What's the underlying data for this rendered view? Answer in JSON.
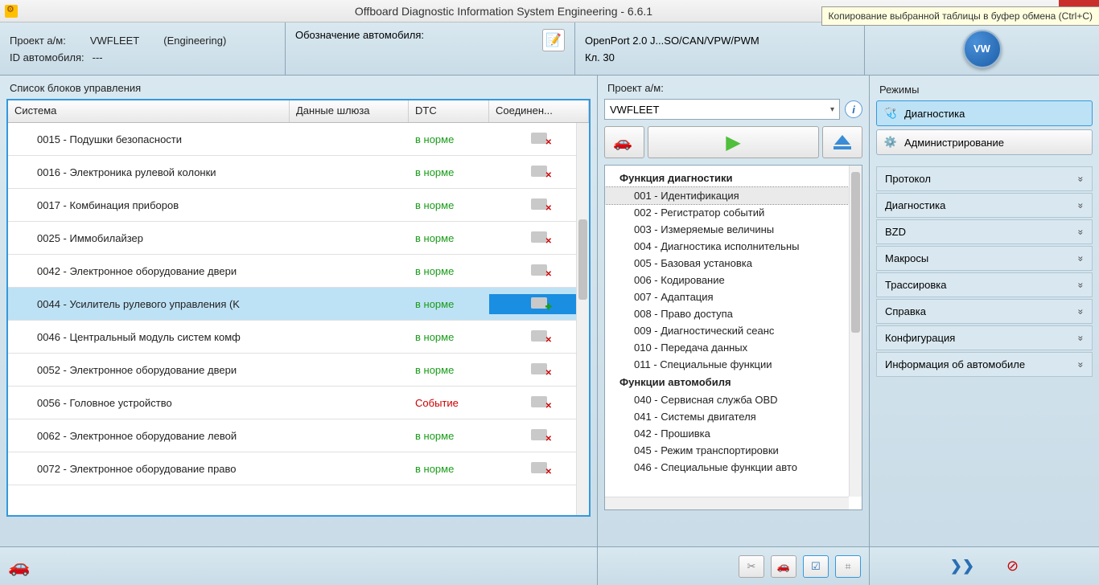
{
  "window": {
    "title": "Offboard Diagnostic Information System Engineering - 6.6.1"
  },
  "infobar": {
    "project_label": "Проект а/м:",
    "project_value": "VWFLEET",
    "engineering": "(Engineering)",
    "id_label": "ID автомобиля:",
    "id_value": "---",
    "designation_label": "Обозначение автомобиля:",
    "interface": "OpenPort 2.0 J...SO/CAN/VPW/PWM",
    "clamp": "Кл. 30",
    "logo_text": "VW"
  },
  "table": {
    "title": "Список блоков управления",
    "columns": {
      "sys": "Система",
      "gw": "Данные шлюза",
      "dtc": "DTC",
      "conn": "Соединен..."
    },
    "dtc_ok": "в норме",
    "dtc_event": "Событие",
    "rows": [
      {
        "sys": "0015 - Подушки безопасности",
        "dtc": "ok",
        "conn": "err"
      },
      {
        "sys": "0016 - Электроника рулевой колонки",
        "dtc": "ok",
        "conn": "err"
      },
      {
        "sys": "0017 - Комбинация приборов",
        "dtc": "ok",
        "conn": "err"
      },
      {
        "sys": "0025 - Иммобилайзер",
        "dtc": "ok",
        "conn": "err"
      },
      {
        "sys": "0042 - Электронное оборудование двери",
        "dtc": "ok",
        "conn": "err"
      },
      {
        "sys": "0044 - Усилитель рулевого управления  (K",
        "dtc": "ok",
        "conn": "ok",
        "sel": true
      },
      {
        "sys": "0046 - Центральный модуль систем комф",
        "dtc": "ok",
        "conn": "err"
      },
      {
        "sys": "0052 - Электронное оборудование двери",
        "dtc": "ok",
        "conn": "err"
      },
      {
        "sys": "0056 - Головное устройство",
        "dtc": "event",
        "conn": "err"
      },
      {
        "sys": "0062 - Электронное оборудование левой",
        "dtc": "ok",
        "conn": "err"
      },
      {
        "sys": "0072 - Электронное оборудование право",
        "dtc": "ok",
        "conn": "err"
      }
    ]
  },
  "mid": {
    "project_label": "Проект а/м:",
    "combo_value": "VWFLEET",
    "tree_group1": "Функция диагностики",
    "tree_group2": "Функции автомобиля",
    "tree1": [
      "001 - Идентификация",
      "002 - Регистратор событий",
      "003 - Измеряемые величины",
      "004 - Диагностика исполнительны",
      "005 - Базовая установка",
      "006 - Кодирование",
      "007 - Адаптация",
      "008 - Право доступа",
      "009 - Диагностический сеанс",
      "010 - Передача данных",
      "011 - Специальные функции"
    ],
    "tree2": [
      "040 - Сервисная служба OBD",
      "041 - Системы двигателя",
      "042 - Прошивка",
      "045 - Режим транспортировки",
      "046 - Специальные функции авто"
    ]
  },
  "right": {
    "title": "Режимы",
    "modes": {
      "diag": "Диагностика",
      "admin": "Администрирование"
    },
    "accordion": [
      "Протокол",
      "Диагностика",
      "BZD",
      "Макросы",
      "Трассировка",
      "Справка",
      "Конфигурация",
      "Информация об автомобиле"
    ]
  },
  "footer": {
    "tooltip": "Копирование выбранной таблицы в буфер обмена (Ctrl+C)"
  }
}
